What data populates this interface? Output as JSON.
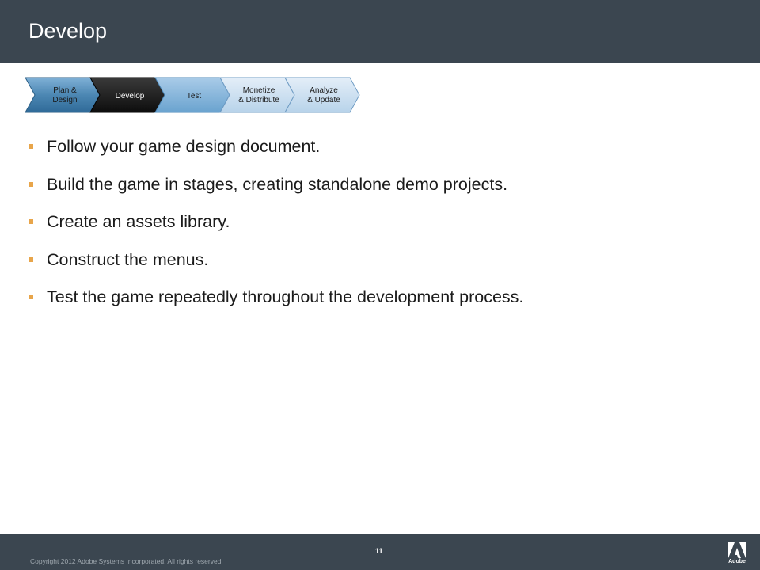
{
  "slide": {
    "title": "Develop",
    "process_steps": [
      {
        "line1": "Plan &",
        "line2": "Design",
        "active": false
      },
      {
        "line1": "Develop",
        "line2": "",
        "active": true
      },
      {
        "line1": "Test",
        "line2": "",
        "active": false
      },
      {
        "line1": "Monetize",
        "line2": "& Distribute",
        "active": false
      },
      {
        "line1": "Analyze",
        "line2": "& Update",
        "active": false
      }
    ],
    "bullets": [
      "Follow your game design document.",
      "Build the game in stages, creating standalone demo projects.",
      "Create an assets library.",
      "Construct the menus.",
      "Test the game repeatedly throughout the development process."
    ]
  },
  "footer": {
    "copyright": "Copyright 2012 Adobe Systems Incorporated.  All rights reserved.",
    "page_number": "11",
    "logo_text": "Adobe"
  },
  "colors": {
    "header_bg": "#3b4650",
    "bullet_marker": "#e8a54a",
    "step_active": "#1a1a1a",
    "step_plan": "#4c87b3",
    "step_light": "#c9ddef"
  }
}
